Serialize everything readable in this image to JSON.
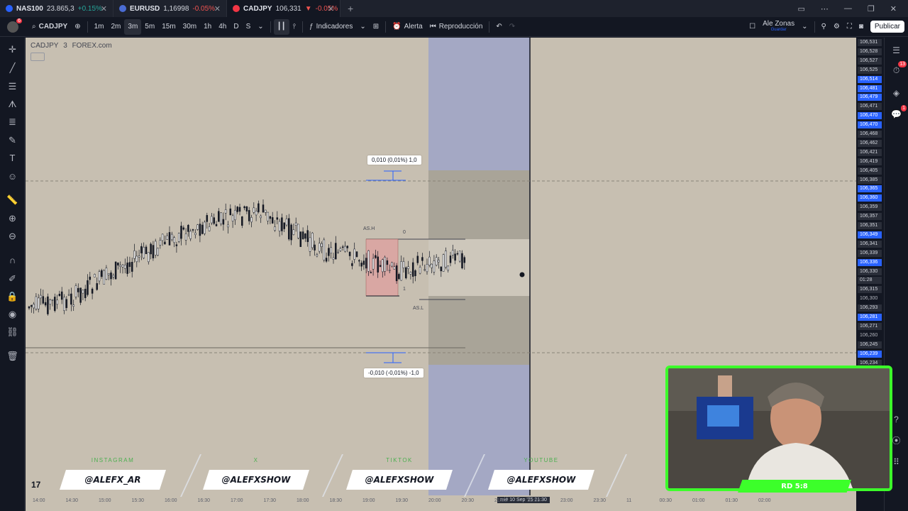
{
  "tabs": [
    {
      "symbol": "NAS100",
      "price": "23.865,3",
      "change": "+0.15%",
      "dir": "up",
      "icon_color": "#2962ff"
    },
    {
      "symbol": "EURUSD",
      "price": "1,16998",
      "change": "-0.05%",
      "dir": "down",
      "icon_color": "#4a6cd4"
    },
    {
      "symbol": "CADJPY",
      "price": "106,331",
      "change": "-0.05%",
      "dir": "down",
      "icon_color": "#f23645",
      "arrow": "▼"
    }
  ],
  "toolbar": {
    "user_badge": "6",
    "symbol": "CADJPY",
    "timeframes": [
      "1m",
      "2m",
      "3m",
      "5m",
      "15m",
      "30m",
      "1h",
      "4h",
      "D",
      "S"
    ],
    "selected_timeframe": "3m",
    "indicators_label": "Indicadores",
    "alert_label": "Alerta",
    "replay_label": "Reproducción",
    "layout_name": "Ale Zonas",
    "layout_sub": "Guardar",
    "publish_label": "Publicar"
  },
  "chart": {
    "symbol": "CADJPY",
    "interval": "3",
    "broker": "FOREX.com",
    "measure_top": "0,010 (0,01%) 1,0",
    "measure_bottom": "-0,010 (-0,01%) -1,0",
    "as_high": "AS.H",
    "as_low": "AS.L",
    "zero_label": "0",
    "one_label": "1"
  },
  "price_axis": [
    {
      "v": "106,531",
      "t": "dark"
    },
    {
      "v": "106,528",
      "t": "dark"
    },
    {
      "v": "106,527",
      "t": "dark"
    },
    {
      "v": "106,525",
      "t": "dark"
    },
    {
      "v": "106,514",
      "t": "blue"
    },
    {
      "v": "106,481",
      "t": "blue"
    },
    {
      "v": "106,479",
      "t": "blue"
    },
    {
      "v": "106,471",
      "t": "dark"
    },
    {
      "v": "106,470",
      "t": "blue"
    },
    {
      "v": "106,470",
      "t": "blue"
    },
    {
      "v": "106,468",
      "t": "dark"
    },
    {
      "v": "106,462",
      "t": "dark"
    },
    {
      "v": "106,421",
      "t": "dark"
    },
    {
      "v": "106,419",
      "t": "dark"
    },
    {
      "v": "106,405",
      "t": "dark"
    },
    {
      "v": "106,385",
      "t": "dark"
    },
    {
      "v": "106,365",
      "t": "blue"
    },
    {
      "v": "106,360",
      "t": "blue"
    },
    {
      "v": "106,359",
      "t": "dark"
    },
    {
      "v": "106,357",
      "t": "dark"
    },
    {
      "v": "106,351",
      "t": "dark"
    },
    {
      "v": "106,349",
      "t": "blue"
    },
    {
      "v": "106,341",
      "t": "dark"
    },
    {
      "v": "106,339",
      "t": "dark"
    },
    {
      "v": "106,336",
      "t": "blue"
    },
    {
      "v": "106,330",
      "t": "dark"
    },
    {
      "v": "01:28",
      "t": "dark"
    },
    {
      "v": "106,315",
      "t": "dark"
    },
    {
      "v": "106,300",
      "t": "none"
    },
    {
      "v": "106,293",
      "t": "dark"
    },
    {
      "v": "106,281",
      "t": "blue"
    },
    {
      "v": "106,271",
      "t": "dark"
    },
    {
      "v": "106,260",
      "t": "none"
    },
    {
      "v": "106,245",
      "t": "dark"
    },
    {
      "v": "106,239",
      "t": "blue"
    },
    {
      "v": "106,234",
      "t": "dark"
    }
  ],
  "time_axis": [
    "14:00",
    "14:30",
    "15:00",
    "15:30",
    "16:00",
    "16:30",
    "17:00",
    "17:30",
    "18:00",
    "18:30",
    "19:00",
    "19:30",
    "20:00",
    "20:30",
    "21:30",
    "22:30",
    "23:00",
    "23:30",
    "11",
    "00:30",
    "01:00",
    "01:30",
    "02:00"
  ],
  "crosshair_time": "mié 10 Sep '25   21:30",
  "social": [
    {
      "platform": "INSTAGRAM",
      "handle": "@ALEFX_AR"
    },
    {
      "platform": "X",
      "handle": "@ALEFXSHOW"
    },
    {
      "platform": "TIKTOK",
      "handle": "@ALEFXSHOW"
    },
    {
      "platform": "YOUTUBE",
      "handle": "@ALEFXSHOW"
    }
  ],
  "webcam_label": "RD 5:8",
  "right_badges": {
    "alerts": "13",
    "chat": "1"
  }
}
